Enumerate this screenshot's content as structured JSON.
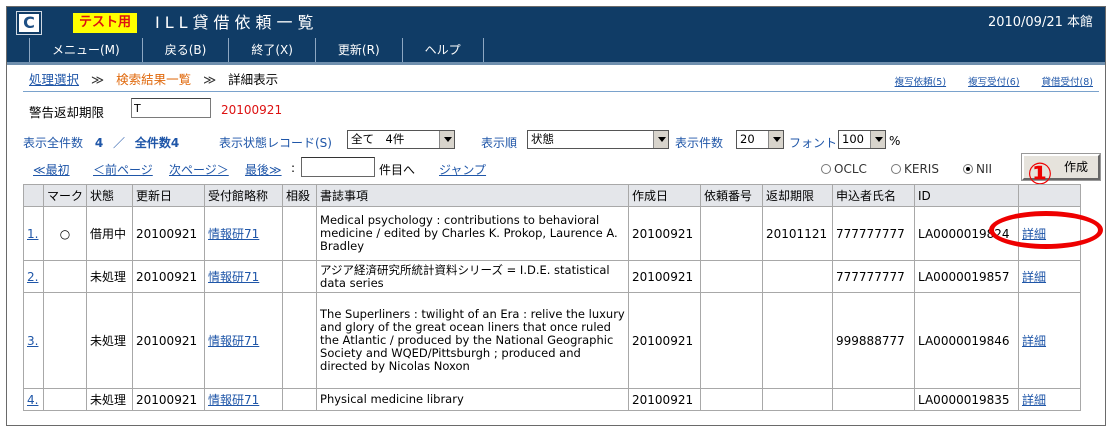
{
  "header": {
    "logo": "C",
    "test_badge": "テスト用",
    "title": "ILL貸借依頼一覧",
    "date_location": "2010/09/21 本館"
  },
  "menu": [
    {
      "label": "メニュー(M)"
    },
    {
      "label": "戻る(B)"
    },
    {
      "label": "終了(X)"
    },
    {
      "label": "更新(R)"
    },
    {
      "label": "ヘルプ"
    }
  ],
  "breadcrumb": {
    "item1": "処理選択",
    "sep": "≫",
    "item2": "検索結果一覧",
    "item3": "詳細表示"
  },
  "top_links": [
    "複写依頼(5)",
    "複写受付(6)",
    "貸借受付(8)"
  ],
  "warning": {
    "label": "警告返却期限",
    "input_value": "T",
    "date": "20100921"
  },
  "filters": {
    "total_label": "表示全件数",
    "total_value": "4",
    "slash": "／",
    "all_label": "全件数4",
    "status_record_label": "表示状態レコード(S)",
    "status_record_value": "全て　4件",
    "order_label": "表示順",
    "order_value": "状態",
    "count_label": "表示件数",
    "count_value": "20",
    "font_label": "フォント",
    "font_value": "100",
    "percent": "%"
  },
  "nav": {
    "first": "≪最初",
    "prev": "＜前ページ",
    "next": "次ページ＞",
    "last": "最後≫",
    "colon": ":",
    "page_input": "",
    "go_suffix": "件目へ",
    "jump": "ジャンプ",
    "radios": [
      {
        "label": "OCLC",
        "checked": false
      },
      {
        "label": "KERIS",
        "checked": false
      },
      {
        "label": "NII",
        "checked": true
      }
    ],
    "create_button": "作成",
    "annotation": "①"
  },
  "table": {
    "headers": [
      "",
      "マーク",
      "状態",
      "更新日",
      "受付館略称",
      "相殺",
      "書誌事項",
      "作成日",
      "依頼番号",
      "返却期限",
      "申込者氏名",
      "ID",
      ""
    ],
    "rows": [
      {
        "no": "1.",
        "mark": "○",
        "status": "借用中",
        "updated": "20100921",
        "library": "情報研71",
        "offset": "",
        "biblio": "Medical psychology : contributions to behavioral medicine / edited by Charles K. Prokop, Laurence A. Bradley",
        "created": "20100921",
        "request_no": "",
        "due": "20101121",
        "applicant": "777777777",
        "id": "LA0000019824",
        "detail": "詳細"
      },
      {
        "no": "2.",
        "mark": "",
        "status": "未処理",
        "updated": "20100921",
        "library": "情報研71",
        "offset": "",
        "biblio": "アジア経済研究所統計資料シリーズ = I.D.E. statistical data series",
        "created": "20100921",
        "request_no": "",
        "due": "",
        "applicant": "777777777",
        "id": "LA0000019857",
        "detail": "詳細"
      },
      {
        "no": "3.",
        "mark": "",
        "status": "未処理",
        "updated": "20100921",
        "library": "情報研71",
        "offset": "",
        "biblio": "The Superliners : twilight of an Era : relive the luxury and glory of the great ocean liners that once ruled the Atlantic / produced by the National Geographic Society and WQED/Pittsburgh ; produced and directed by Nicolas Noxon",
        "created": "20100921",
        "request_no": "",
        "due": "",
        "applicant": "999888777",
        "id": "LA0000019846",
        "detail": "詳細"
      },
      {
        "no": "4.",
        "mark": "",
        "status": "未処理",
        "updated": "20100921",
        "library": "情報研71",
        "offset": "",
        "biblio": "Physical medicine library",
        "created": "20100921",
        "request_no": "",
        "due": "",
        "applicant": "",
        "id": "LA0000019835",
        "detail": "詳細"
      }
    ]
  },
  "colors": {
    "header_bg": "#103c66",
    "link": "#1f56a8",
    "warning_red": "#dd1111",
    "annotation_red": "#ee0000",
    "badge_yellow": "#ffff00"
  }
}
